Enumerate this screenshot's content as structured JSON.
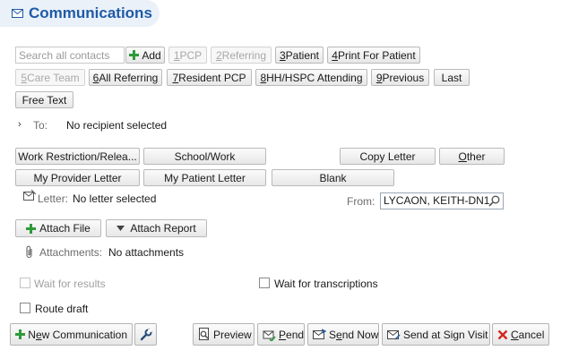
{
  "header": {
    "title": "Communications",
    "icon": "envelope-icon"
  },
  "search": {
    "placeholder": "Search all contacts",
    "add_label": "Add"
  },
  "recipient_buttons": [
    {
      "key": "1",
      "rest": " PCP",
      "enabled": false
    },
    {
      "key": "2",
      "rest": " Referring",
      "enabled": false
    },
    {
      "key": "3",
      "rest": " Patient",
      "enabled": true
    },
    {
      "key": "4",
      "rest": " Print For Patient",
      "enabled": true
    },
    {
      "key": "5",
      "rest": " Care Team",
      "enabled": false
    },
    {
      "key": "6",
      "rest": " All Referring",
      "enabled": true
    },
    {
      "key": "7",
      "rest": " Resident PCP",
      "enabled": true
    },
    {
      "key": "8",
      "rest": " HH/HSPC Attending",
      "enabled": true
    },
    {
      "key": "9",
      "rest": " Previous",
      "enabled": true
    },
    {
      "key": "",
      "rest": "Last",
      "enabled": true
    },
    {
      "key": "",
      "rest": "Free Text",
      "enabled": true
    }
  ],
  "to": {
    "label": "To:",
    "value": "No recipient selected"
  },
  "letter_buttons": {
    "work_restriction": "Work Restriction/Relea...",
    "school_work": "School/Work",
    "copy_letter": "Copy Letter",
    "other_key": "O",
    "other_rest": "ther",
    "my_provider_letter": "My Provider Letter",
    "my_patient_letter": "My Patient Letter",
    "blank": "Blank"
  },
  "letter": {
    "label": "Letter:",
    "value": "No letter selected"
  },
  "from": {
    "label": "From:",
    "value": "LYCAON, KEITH-DN1"
  },
  "attach": {
    "file_label": "Attach File",
    "report_label": "Attach Report"
  },
  "attachments": {
    "label": "Attachments:",
    "value": "No attachments"
  },
  "options": {
    "wait_results": "Wait for results",
    "wait_transcriptions": "Wait for transcriptions",
    "route_draft": "Route draft"
  },
  "footer": {
    "new_comm_pre": "N",
    "new_comm_key": "e",
    "new_comm_post": "w Communication",
    "preview": "Preview",
    "pend_key": "P",
    "pend_rest": "end",
    "send_now_pre": "S",
    "send_now_key": "e",
    "send_now_post": "nd Now",
    "send_sign": "Send at Sign Visit",
    "cancel_key": "C",
    "cancel_rest": "ancel"
  },
  "colors": {
    "accent": "#1f5aa6",
    "header_bg": "#eaf1f9",
    "add_green": "#2e9a3a",
    "cancel_red": "#d0281f"
  }
}
